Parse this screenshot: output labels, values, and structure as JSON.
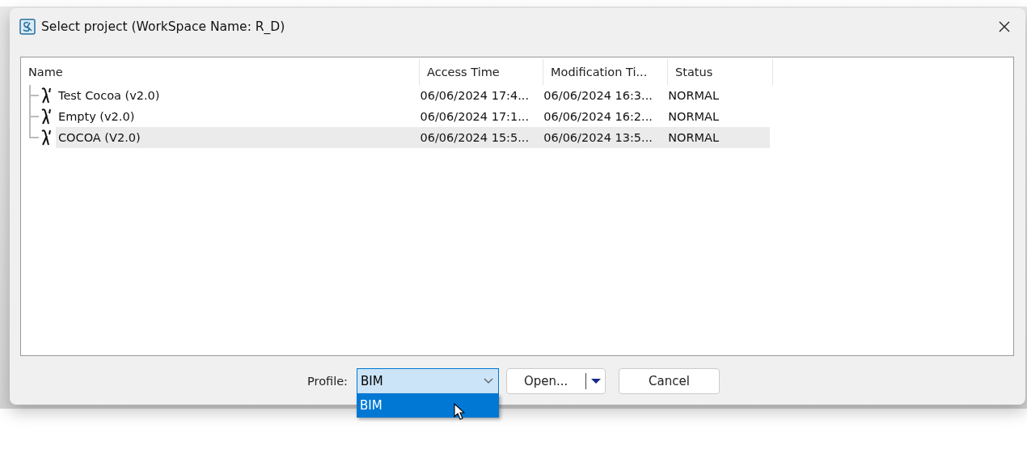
{
  "window": {
    "title": "Select project (WorkSpace Name: R_D)"
  },
  "table": {
    "columns": [
      "Name",
      "Access Time",
      "Modification Ti...",
      "Status"
    ],
    "rows": [
      {
        "name": "Test Cocoa (v2.0)",
        "access_time": "06/06/2024 17:4...",
        "modification_time": "06/06/2024 16:3...",
        "status": "NORMAL",
        "selected": false
      },
      {
        "name": "Empty (v2.0)",
        "access_time": "06/06/2024 17:1...",
        "modification_time": "06/06/2024 16:2...",
        "status": "NORMAL",
        "selected": false
      },
      {
        "name": "COCOA (V2.0)",
        "access_time": "06/06/2024 15:5...",
        "modification_time": "06/06/2024 13:5...",
        "status": "NORMAL",
        "selected": true
      }
    ]
  },
  "profile": {
    "label": "Profile:",
    "value": "BIM",
    "expanded": true,
    "options": [
      {
        "label": "BIM",
        "selected": true
      }
    ]
  },
  "buttons": {
    "open": "Open...",
    "cancel": "Cancel"
  }
}
